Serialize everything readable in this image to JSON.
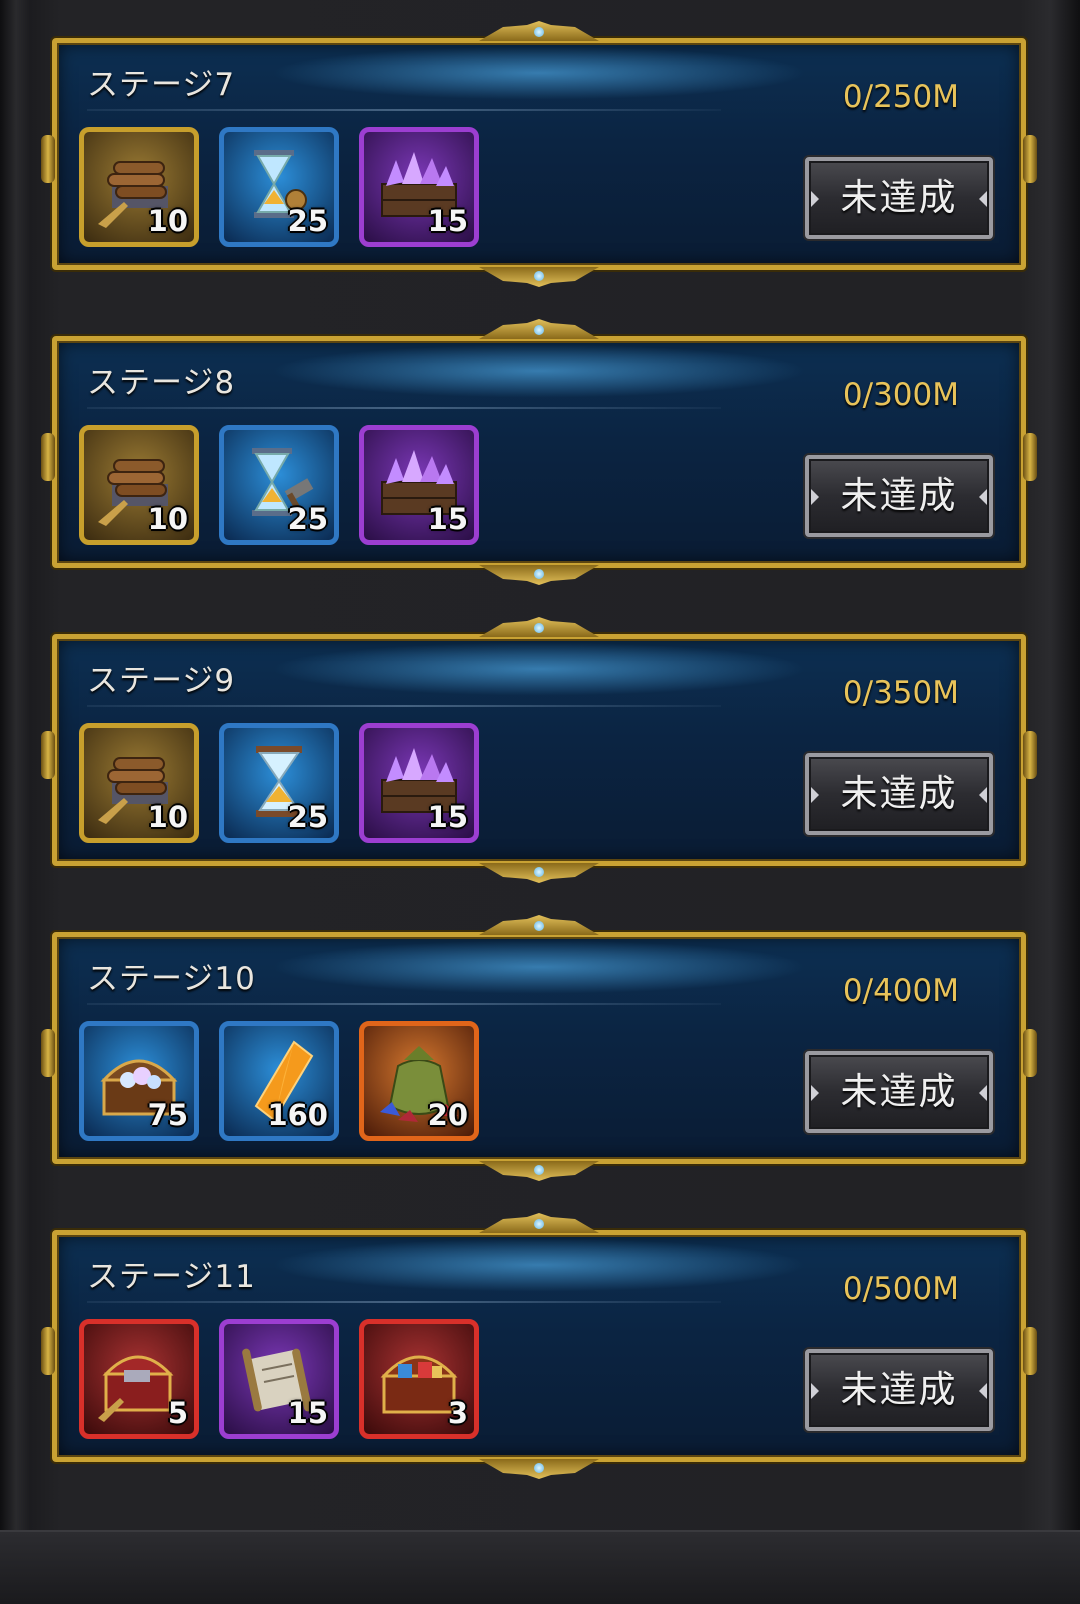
{
  "stages": [
    {
      "title": "ステージ7",
      "progress": "0/250M",
      "status_label": "未達成",
      "rewards": [
        {
          "icon": "lumber-bundle-icon",
          "frame": "gold",
          "qty": "10"
        },
        {
          "icon": "hourglass-speedup-icon",
          "frame": "blue",
          "qty": "25"
        },
        {
          "icon": "amethyst-crate-icon",
          "frame": "purple",
          "qty": "15"
        }
      ]
    },
    {
      "title": "ステージ8",
      "progress": "0/300M",
      "status_label": "未達成",
      "rewards": [
        {
          "icon": "lumber-bundle-icon",
          "frame": "gold",
          "qty": "10"
        },
        {
          "icon": "hourglass-hammer-icon",
          "frame": "blue",
          "qty": "25"
        },
        {
          "icon": "amethyst-crate-icon",
          "frame": "purple",
          "qty": "15"
        }
      ]
    },
    {
      "title": "ステージ9",
      "progress": "0/350M",
      "status_label": "未達成",
      "rewards": [
        {
          "icon": "lumber-bundle-icon",
          "frame": "gold",
          "qty": "10"
        },
        {
          "icon": "hourglass-icon",
          "frame": "blue",
          "qty": "25"
        },
        {
          "icon": "amethyst-crate-icon",
          "frame": "purple",
          "qty": "15"
        }
      ]
    },
    {
      "title": "ステージ10",
      "progress": "0/400M",
      "status_label": "未達成",
      "rewards": [
        {
          "icon": "gem-chest-icon",
          "frame": "blue",
          "qty": "75"
        },
        {
          "icon": "orange-crystal-icon",
          "frame": "blue",
          "qty": "160"
        },
        {
          "icon": "gem-sack-icon",
          "frame": "orange",
          "qty": "20"
        }
      ]
    },
    {
      "title": "ステージ11",
      "progress": "0/500M",
      "status_label": "未達成",
      "rewards": [
        {
          "icon": "resource-chest-icon",
          "frame": "red",
          "qty": "5"
        },
        {
          "icon": "scroll-icon",
          "frame": "purple",
          "qty": "15"
        },
        {
          "icon": "treasure-chest-icon",
          "frame": "red",
          "qty": "3"
        }
      ]
    }
  ]
}
